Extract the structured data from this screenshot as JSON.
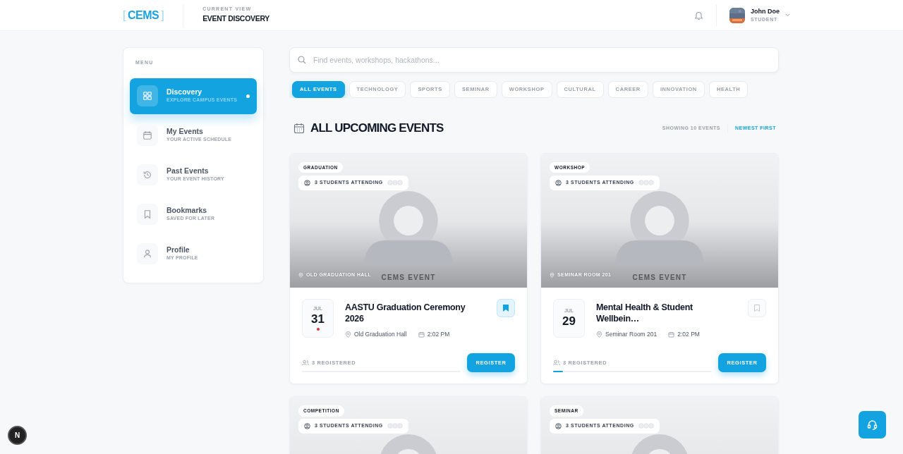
{
  "header": {
    "logo_open": "[",
    "logo": "CEMS",
    "logo_close": "]",
    "view_label": "CURRENT VIEW",
    "view_title": "EVENT DISCOVERY",
    "user": {
      "name": "John Doe",
      "role": "STUDENT"
    }
  },
  "sidebar": {
    "heading": "MENU",
    "items": [
      {
        "label": "Discovery",
        "sublabel": "EXPLORE CAMPUS EVENTS",
        "selected": true
      },
      {
        "label": "My Events",
        "sublabel": "YOUR ACTIVE SCHEDULE",
        "selected": false
      },
      {
        "label": "Past Events",
        "sublabel": "YOUR EVENT HISTORY",
        "selected": false
      },
      {
        "label": "Bookmarks",
        "sublabel": "SAVED FOR LATER",
        "selected": false
      },
      {
        "label": "Profile",
        "sublabel": "MY PROFILE",
        "selected": false
      }
    ]
  },
  "search": {
    "placeholder": "Find events, workshops, hackathons..."
  },
  "filters": [
    {
      "label": "ALL EVENTS",
      "selected": true
    },
    {
      "label": "TECHNOLOGY",
      "selected": false
    },
    {
      "label": "SPORTS",
      "selected": false
    },
    {
      "label": "SEMINAR",
      "selected": false
    },
    {
      "label": "WORKSHOP",
      "selected": false
    },
    {
      "label": "CULTURAL",
      "selected": false
    },
    {
      "label": "CAREER",
      "selected": false
    },
    {
      "label": "INNOVATION",
      "selected": false
    },
    {
      "label": "HEALTH",
      "selected": false
    }
  ],
  "section": {
    "title": "ALL UPCOMING EVENTS",
    "count": "SHOWING 10 EVENTS",
    "sort": "NEWEST FIRST"
  },
  "events": [
    {
      "category": "GRADUATION",
      "attending": "3 STUDENTS ATTENDING",
      "image_caption": "CEMS EVENT",
      "image_location": "OLD GRADUATION HALL",
      "month": "JUL",
      "day": "31",
      "flagged": true,
      "title": "AASTU Graduation Ceremony 2026",
      "location": "Old Graduation Hall",
      "time": "2:02 PM",
      "bookmarked": true,
      "registered": "3 REGISTERED",
      "level": 0,
      "button": "REGISTER"
    },
    {
      "category": "WORKSHOP",
      "attending": "3 STUDENTS ATTENDING",
      "image_caption": "CEMS EVENT",
      "image_location": "SEMINAR ROOM 201",
      "month": "JUL",
      "day": "29",
      "flagged": false,
      "title": "Mental Health & Student Wellbein…",
      "location": "Seminar Room 201",
      "time": "2:02 PM",
      "bookmarked": false,
      "registered": "3 REGISTERED",
      "level": 0.06,
      "button": "REGISTER"
    },
    {
      "category": "COMPETITION",
      "attending": "3 STUDENTS ATTENDING"
    },
    {
      "category": "SEMINAR",
      "attending": "3 STUDENTS ATTENDING"
    }
  ],
  "dev_badge": "N"
}
